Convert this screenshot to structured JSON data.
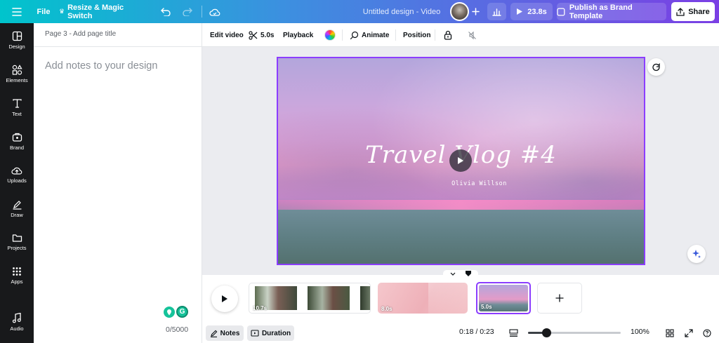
{
  "topbar": {
    "file_label": "File",
    "resize_label": "Resize & Magic Switch",
    "doc_title": "Untitled design - Video",
    "duration": "23.8s",
    "publish_label": "Publish as Brand Template",
    "share_label": "Share"
  },
  "sidebar": {
    "items": [
      {
        "label": "Design",
        "icon": "design-icon"
      },
      {
        "label": "Elements",
        "icon": "elements-icon"
      },
      {
        "label": "Text",
        "icon": "text-icon"
      },
      {
        "label": "Brand",
        "icon": "brand-icon"
      },
      {
        "label": "Uploads",
        "icon": "upload-icon"
      },
      {
        "label": "Draw",
        "icon": "draw-icon"
      },
      {
        "label": "Projects",
        "icon": "folder-icon"
      },
      {
        "label": "Apps",
        "icon": "apps-icon"
      },
      {
        "label": "Audio",
        "icon": "audio-icon"
      }
    ]
  },
  "notes": {
    "page_title": "Page 3 - Add page title",
    "placeholder": "Add notes to your design",
    "char_count": "0/5000"
  },
  "toolbar": {
    "edit_video": "Edit video",
    "trim_duration": "5.0s",
    "playback": "Playback",
    "animate": "Animate",
    "position": "Position"
  },
  "canvas": {
    "title_text": "Travel Vlog #4",
    "subtitle_text": "Olivia  Willson"
  },
  "timeline": {
    "clips": [
      {
        "duration": "10.7s"
      },
      {
        "duration": "8.0s"
      },
      {
        "duration": "5.0s"
      }
    ],
    "notes_label": "Notes",
    "duration_label": "Duration",
    "time_readout": "0:18 / 0:23",
    "zoom_level": "100%",
    "zoom_fraction": 0.2
  },
  "colors": {
    "accent": "#8b3dff",
    "topbar_start": "#00c4cc",
    "topbar_end": "#7b3fe4",
    "sidebar_bg": "#18191b"
  }
}
